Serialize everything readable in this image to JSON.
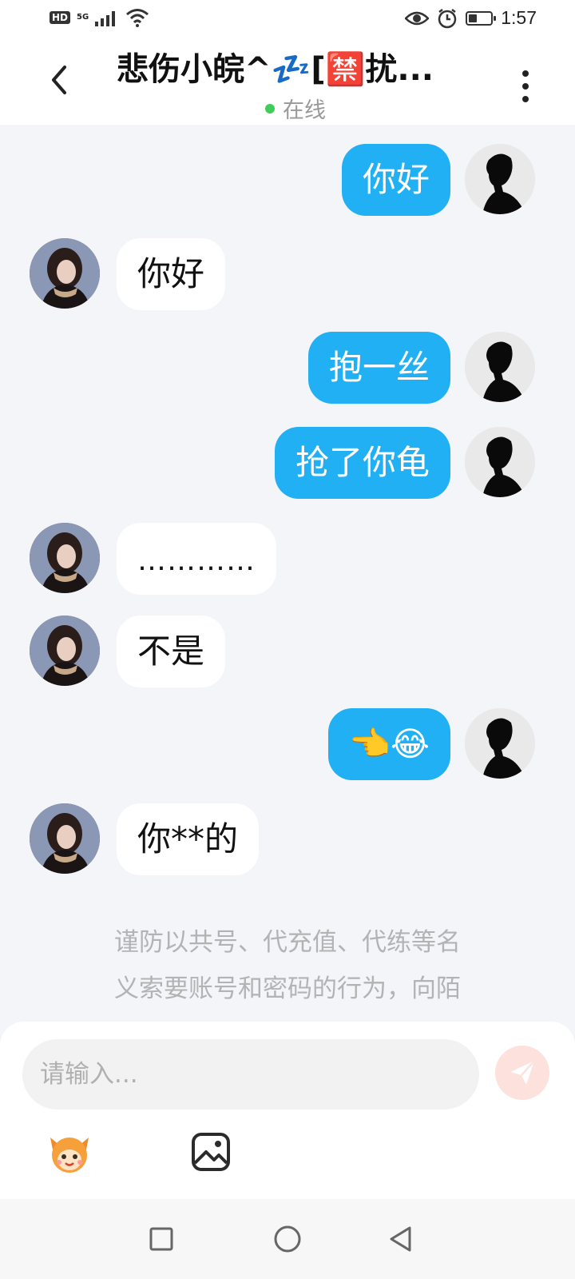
{
  "status_bar": {
    "hd": "HD",
    "network": "5G",
    "time": "1:57"
  },
  "header": {
    "title": "悲伤小皖^💤[🈲扰...",
    "online": "在线"
  },
  "messages": [
    {
      "side": "me",
      "text": "你好"
    },
    {
      "side": "other",
      "text": "你好"
    },
    {
      "side": "me",
      "text": "抱一丝"
    },
    {
      "side": "me",
      "text": "抢了你龟"
    },
    {
      "side": "other",
      "text": "…………"
    },
    {
      "side": "other",
      "text": "不是"
    },
    {
      "side": "me",
      "text": "👈😂"
    },
    {
      "side": "other",
      "text": "你**的"
    }
  ],
  "notice": {
    "line1": "谨防以共号、代充值、代练等名",
    "line2": "义索要账号和密码的行为，向陌"
  },
  "composer": {
    "placeholder": "请输入..."
  },
  "colors": {
    "my_bubble": "#20b0f3",
    "other_bubble": "#ffffff",
    "online_dot": "#3fce5b",
    "send_button": "#fde1dc"
  }
}
